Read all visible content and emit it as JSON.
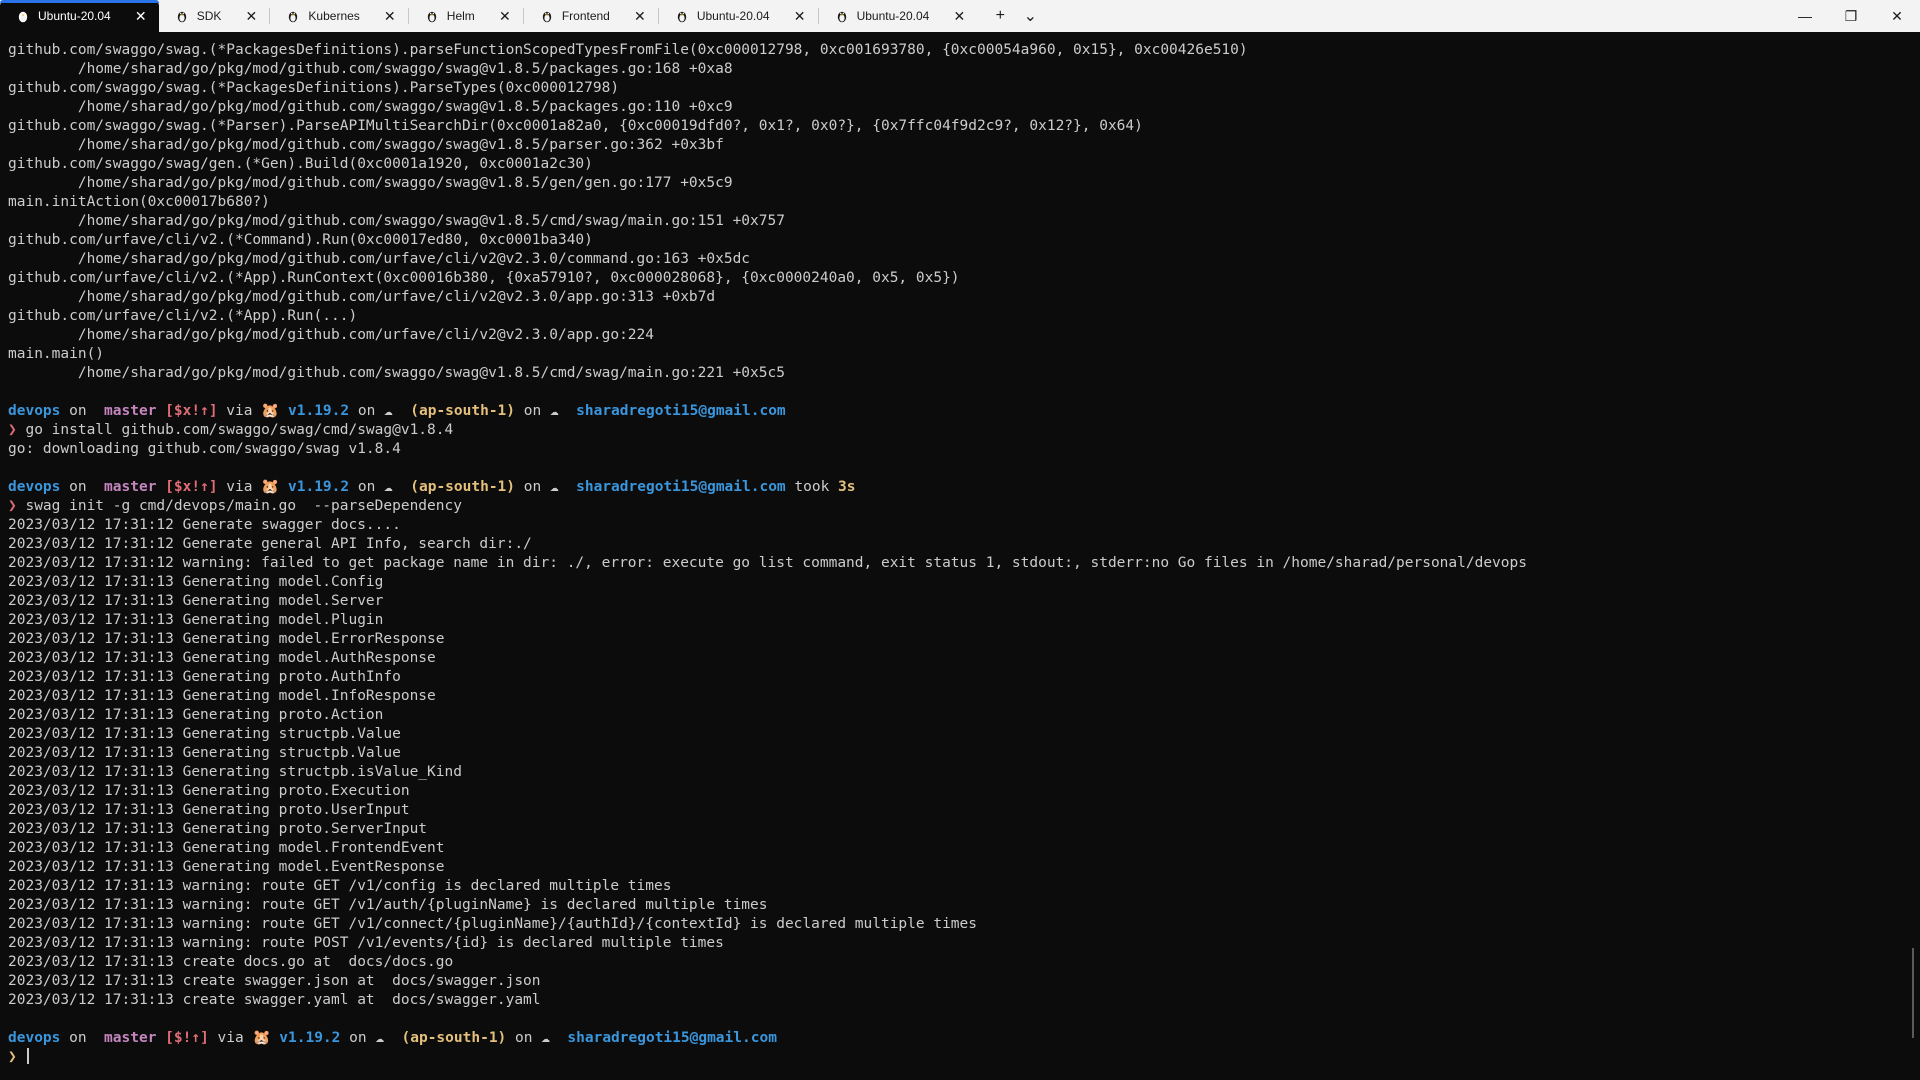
{
  "tabs": [
    {
      "label": "Ubuntu-20.04",
      "active": true
    },
    {
      "label": "SDK",
      "active": false
    },
    {
      "label": "Kubernes",
      "active": false
    },
    {
      "label": "Helm",
      "active": false
    },
    {
      "label": "Frontend",
      "active": false
    },
    {
      "label": "Ubuntu-20.04",
      "active": false
    },
    {
      "label": "Ubuntu-20.04",
      "active": false
    }
  ],
  "toolbar": {
    "new_tab": "+",
    "dropdown": "⌄"
  },
  "window_controls": {
    "minimize": "—",
    "maximize": "❐",
    "close": "✕"
  },
  "colors": {
    "accent": "#2a73e8",
    "terminal_bg": "#0c0c0c",
    "prompt_dir": "#3a96dd",
    "prompt_branch": "#c586c0",
    "prompt_region": "#e5c07b",
    "prompt_status": "#e06c75"
  },
  "trace": [
    "github.com/swaggo/swag.(*PackagesDefinitions).parseFunctionScopedTypesFromFile(0xc000012798, 0xc001693780, {0xc00054a960, 0x15}, 0xc00426e510)",
    "        /home/sharad/go/pkg/mod/github.com/swaggo/swag@v1.8.5/packages.go:168 +0xa8",
    "github.com/swaggo/swag.(*PackagesDefinitions).ParseTypes(0xc000012798)",
    "        /home/sharad/go/pkg/mod/github.com/swaggo/swag@v1.8.5/packages.go:110 +0xc9",
    "github.com/swaggo/swag.(*Parser).ParseAPIMultiSearchDir(0xc0001a82a0, {0xc00019dfd0?, 0x1?, 0x0?}, {0x7ffc04f9d2c9?, 0x12?}, 0x64)",
    "        /home/sharad/go/pkg/mod/github.com/swaggo/swag@v1.8.5/parser.go:362 +0x3bf",
    "github.com/swaggo/swag/gen.(*Gen).Build(0xc0001a1920, 0xc0001a2c30)",
    "        /home/sharad/go/pkg/mod/github.com/swaggo/swag@v1.8.5/gen/gen.go:177 +0x5c9",
    "main.initAction(0xc00017b680?)",
    "        /home/sharad/go/pkg/mod/github.com/swaggo/swag@v1.8.5/cmd/swag/main.go:151 +0x757",
    "github.com/urfave/cli/v2.(*Command).Run(0xc00017ed80, 0xc0001ba340)",
    "        /home/sharad/go/pkg/mod/github.com/urfave/cli/v2@v2.3.0/command.go:163 +0x5dc",
    "github.com/urfave/cli/v2.(*App).RunContext(0xc00016b380, {0xa57910?, 0xc000028068}, {0xc0000240a0, 0x5, 0x5})",
    "        /home/sharad/go/pkg/mod/github.com/urfave/cli/v2@v2.3.0/app.go:313 +0xb7d",
    "github.com/urfave/cli/v2.(*App).Run(...)",
    "        /home/sharad/go/pkg/mod/github.com/urfave/cli/v2@v2.3.0/app.go:224",
    "main.main()",
    "        /home/sharad/go/pkg/mod/github.com/swaggo/swag@v1.8.5/cmd/swag/main.go:221 +0x5c5"
  ],
  "prompt1": {
    "dir": "devops",
    "on": " on ",
    "branch_icon": "",
    "branch": "master",
    "status": "[$x!↑]",
    "via": " via ",
    "go_icon": "🐹",
    "go_version": "v1.19.2",
    "on2": " on ",
    "cloud_icon": "☁",
    "region": "(ap-south-1)",
    "on3": " on ",
    "account": "sharadregoti15@gmail.com",
    "arrow": "❯",
    "command": "go install github.com/swaggo/swag/cmd/swag@v1.8.4"
  },
  "output1": [
    "go: downloading github.com/swaggo/swag v1.8.4"
  ],
  "prompt2": {
    "dir": "devops",
    "on": " on ",
    "branch_icon": "",
    "branch": "master",
    "status": "[$x!↑]",
    "via": " via ",
    "go_icon": "🐹",
    "go_version": "v1.19.2",
    "on2": " on ",
    "cloud_icon": "☁",
    "region": "(ap-south-1)",
    "on3": " on ",
    "account": "sharadregoti15@gmail.com",
    "took": " took ",
    "duration": "3s",
    "arrow": "❯",
    "command": "swag init -g cmd/devops/main.go  --parseDependency"
  },
  "output2": [
    "2023/03/12 17:31:12 Generate swagger docs....",
    "2023/03/12 17:31:12 Generate general API Info, search dir:./",
    "2023/03/12 17:31:12 warning: failed to get package name in dir: ./, error: execute go list command, exit status 1, stdout:, stderr:no Go files in /home/sharad/personal/devops",
    "2023/03/12 17:31:13 Generating model.Config",
    "2023/03/12 17:31:13 Generating model.Server",
    "2023/03/12 17:31:13 Generating model.Plugin",
    "2023/03/12 17:31:13 Generating model.ErrorResponse",
    "2023/03/12 17:31:13 Generating model.AuthResponse",
    "2023/03/12 17:31:13 Generating proto.AuthInfo",
    "2023/03/12 17:31:13 Generating model.InfoResponse",
    "2023/03/12 17:31:13 Generating proto.Action",
    "2023/03/12 17:31:13 Generating structpb.Value",
    "2023/03/12 17:31:13 Generating structpb.Value",
    "2023/03/12 17:31:13 Generating structpb.isValue_Kind",
    "2023/03/12 17:31:13 Generating proto.Execution",
    "2023/03/12 17:31:13 Generating proto.UserInput",
    "2023/03/12 17:31:13 Generating proto.ServerInput",
    "2023/03/12 17:31:13 Generating model.FrontendEvent",
    "2023/03/12 17:31:13 Generating model.EventResponse",
    "2023/03/12 17:31:13 warning: route GET /v1/config is declared multiple times",
    "2023/03/12 17:31:13 warning: route GET /v1/auth/{pluginName} is declared multiple times",
    "2023/03/12 17:31:13 warning: route GET /v1/connect/{pluginName}/{authId}/{contextId} is declared multiple times",
    "2023/03/12 17:31:13 warning: route POST /v1/events/{id} is declared multiple times",
    "2023/03/12 17:31:13 create docs.go at  docs/docs.go",
    "2023/03/12 17:31:13 create swagger.json at  docs/swagger.json",
    "2023/03/12 17:31:13 create swagger.yaml at  docs/swagger.yaml"
  ],
  "prompt3": {
    "dir": "devops",
    "on": " on ",
    "branch_icon": "",
    "branch": "master",
    "status": "[$!↑]",
    "via": " via ",
    "go_icon": "🐹",
    "go_version": "v1.19.2",
    "on2": " on ",
    "cloud_icon": "☁",
    "region": "(ap-south-1)",
    "on3": " on ",
    "account": "sharadregoti15@gmail.com",
    "arrow": "❯",
    "command": ""
  }
}
